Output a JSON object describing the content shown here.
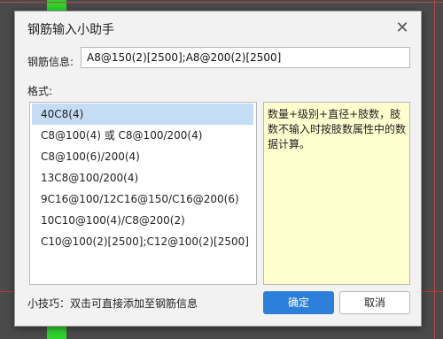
{
  "dialog": {
    "title": "钢筋输入小助手",
    "close_symbol": "✕",
    "info_label": "钢筋信息:",
    "info_value": "A8@150(2)[2500];A8@200(2)[2500]",
    "format_label": "格式:",
    "formats": [
      "40C8(4)",
      "C8@100(4) 或 C8@100/200(4)",
      "C8@100(6)/200(4)",
      "13C8@100/200(4)",
      "9C16@100/12C16@150/C16@200(6)",
      "10C10@100(4)/C8@200(2)",
      "C10@100(2)[2500];C12@100(2)[2500]"
    ],
    "selected_index": 0,
    "description": "数量+级别+直径+肢数，肢数不输入时按肢数属性中的数据计算。",
    "tip": "小技巧：双击可直接添加至钢筋信息",
    "ok_label": "确定",
    "cancel_label": "取消"
  },
  "colors": {
    "accent": "#2d7fdc",
    "selection": "#c5dcf5",
    "description_bg": "#fffecf",
    "canvas_bg": "#4a4a4a",
    "canvas_green": "#2ed12e"
  }
}
